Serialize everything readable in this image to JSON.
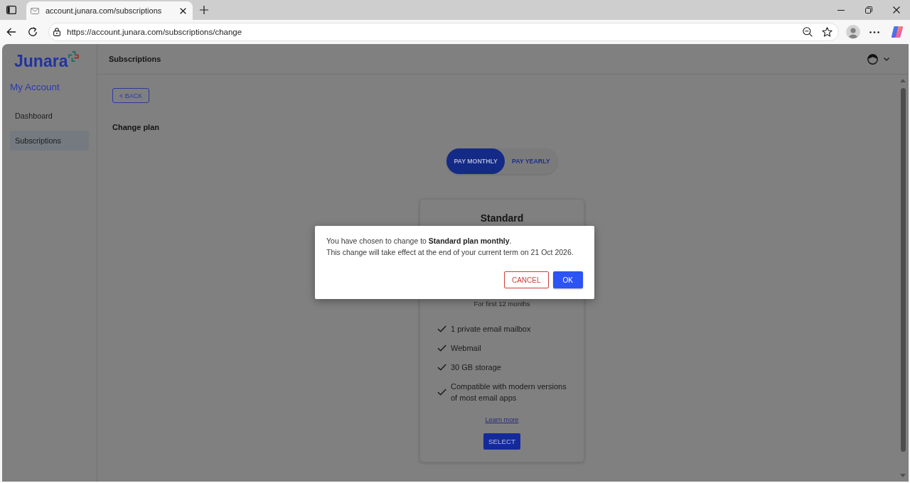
{
  "browser": {
    "tab": {
      "title": "account.junara.com/subscriptions"
    },
    "address": "https://account.junara.com/subscriptions/change"
  },
  "sidebar": {
    "logo": "Junara",
    "heading": "My Account",
    "items": [
      {
        "label": "Dashboard",
        "selected": false
      },
      {
        "label": "Subscriptions",
        "selected": true
      }
    ]
  },
  "header": {
    "title": "Subscriptions"
  },
  "back_button": "< BACK",
  "page_title": "Change plan",
  "billing_toggle": [
    {
      "label": "PAY MONTHLY",
      "selected": true
    },
    {
      "label": "PAY YEARLY",
      "selected": false
    }
  ],
  "plan_card": {
    "name": "Standard",
    "term_note": "For first 12 months",
    "features": [
      "1 private email mailbox",
      "Webmail",
      "30 GB storage",
      "Compatible with modern versions of most email apps"
    ],
    "link": "Learn more",
    "button": "SELECT"
  },
  "dialog": {
    "lines": [
      "You have chosen to change to **Standard plan monthly**.",
      "This change will take effect at the end of your current term on 21 Oct 2026."
    ],
    "buttons": [
      {
        "label": "CANCEL",
        "kind": "outlined"
      },
      {
        "label": "OK",
        "kind": "filled"
      }
    ]
  }
}
